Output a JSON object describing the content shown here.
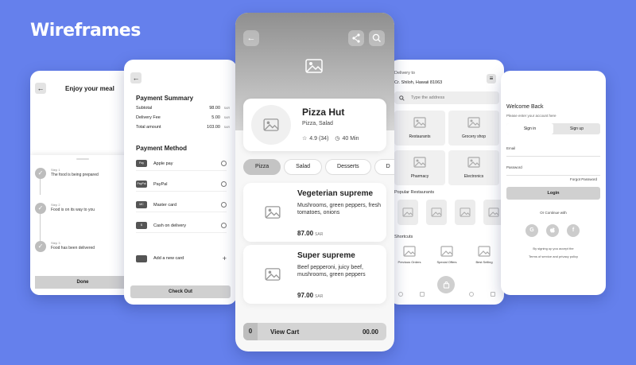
{
  "brand": "Wireframes",
  "tracking": {
    "title": "Enjoy your meal",
    "steps": [
      {
        "label": "Step 1",
        "text": "The food is being prepared"
      },
      {
        "label": "Step 2",
        "text": "Food is on its way to you"
      },
      {
        "label": "Step 3",
        "text": "Food has been delivered"
      }
    ],
    "done_label": "Done"
  },
  "payment": {
    "summary_title": "Payment Summary",
    "summary": [
      {
        "label": "Subtotal",
        "value": "98.00",
        "currency": "SAR"
      },
      {
        "label": "Delivery Fee",
        "value": "5.00",
        "currency": "SAR"
      },
      {
        "label": "Total amount",
        "value": "103.00",
        "currency": "SAR"
      }
    ],
    "method_title": "Payment Method",
    "methods": [
      {
        "label": "Apple pay",
        "badge": "Pay"
      },
      {
        "label": "PayPal",
        "badge": "PayPal"
      },
      {
        "label": "Master card",
        "badge": "MC"
      },
      {
        "label": "Cash on delivery",
        "badge": "$"
      }
    ],
    "add_card_label": "Add a new card",
    "checkout_label": "Check Out"
  },
  "restaurant": {
    "name": "Pizza Hut",
    "categories": "Pizza, Salad",
    "rating": "4.9 (34)",
    "delivery_time": "40 Min",
    "tabs": [
      "Pizza",
      "Salad",
      "Desserts",
      "D"
    ],
    "items": [
      {
        "name": "Vegeterian supreme",
        "desc": "Mushrooms, green peppers, fresh tomatoes, onions",
        "price": "87.00",
        "currency": "SAR"
      },
      {
        "name": "Super supreme",
        "desc": "Beef pepperoni, juicy beef, mushrooms, green peppers",
        "price": "97.00",
        "currency": "SAR"
      }
    ],
    "cart": {
      "qty": "0",
      "label": "View Cart",
      "total": "00.00"
    }
  },
  "home": {
    "delivery_label": "Delivery to",
    "address": "Cr. Shiloh, Hawaii 81063",
    "search_placeholder": "Type the address",
    "categories": [
      "Restaurants",
      "Grocery shop",
      "Pharmacy",
      "Electronics"
    ],
    "popular_title": "Popular Restaurants",
    "shortcuts_title": "Shortcuts",
    "shortcuts": [
      "Previous Orders",
      "Special Offers",
      "Best Selling"
    ]
  },
  "auth": {
    "title": "Welcome Back",
    "subtitle": "Please enter your account here",
    "tabs": [
      "Sign in",
      "Sign up"
    ],
    "email_label": "Email",
    "password_label": "Password",
    "forgot_label": "Forgot Password",
    "login_label": "Login",
    "continue_label": "Or Continue with",
    "socials": [
      "G",
      "",
      "f"
    ],
    "terms_line1": "By signing up you accept the",
    "terms_line2": "Terms of service and privacy policy"
  }
}
